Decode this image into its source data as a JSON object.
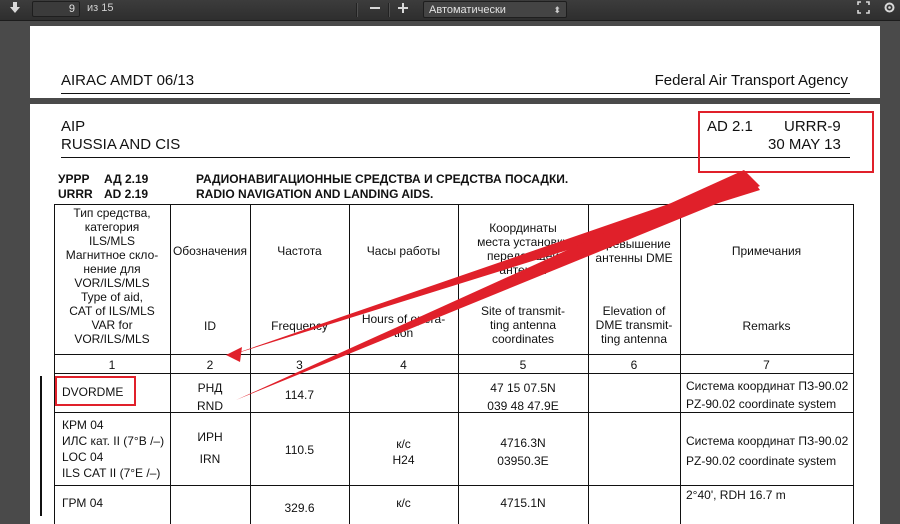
{
  "toolbar": {
    "page_number": "9",
    "page_of": "из 15",
    "zoom_value": "Автоматически",
    "icons": [
      "download-icon",
      "zoom-out-icon",
      "zoom-in-icon",
      "fullscreen-icon",
      "settings-icon"
    ]
  },
  "page_prev": {
    "amdt": "AIRAC AMDT 06/13",
    "agency": "Federal Air Transport Agency"
  },
  "page_header": {
    "aip": "AIP",
    "region": "RUSSIA AND CIS",
    "ad": "AD 2.1",
    "code": "URRR-9",
    "date": "30 MAY 13"
  },
  "section": {
    "code_ru": "УРРР",
    "num_ru": "АД 2.19",
    "code_en": "URRR",
    "num_en": "AD 2.19",
    "title_ru": "РАДИОНАВИГАЦИОННЫЕ СРЕДСТВА И СРЕДСТВА ПОСАДКИ.",
    "title_en": "RADIO NAVIGATION AND LANDING AIDS."
  },
  "table": {
    "headers_ru": [
      "Тип средства, категория ILS/MLS Магнитное скло-нение для VOR/ILS/MLS",
      "Обозначения",
      "Частота",
      "Часы работы",
      "Координаты места установки передающей антенны",
      "Превышение антенны DME",
      "Примечания"
    ],
    "h1_lines": [
      "Тип средства,",
      "категория",
      "ILS/MLS",
      "Магнитное скло-",
      "нение для",
      "VOR/ILS/MLS",
      "Type of aid,",
      "CAT of ILS/MLS",
      "VAR for",
      "VOR/ILS/MLS"
    ],
    "h5_lines": [
      "Координаты",
      "места установки",
      "передающей",
      "антенны"
    ],
    "h5_en_lines": [
      "Site of transmit-",
      "ting antenna",
      "coordinates"
    ],
    "h6_lines": [
      "Превышение",
      "антенны DME"
    ],
    "h6_en_lines": [
      "Elevation of",
      "DME transmit-",
      "ting antenna"
    ],
    "h4_en_lines": [
      "Hours of opera-",
      "tion"
    ],
    "h2": "Обозначения",
    "h3": "Частота",
    "h4": "Часы работы",
    "h7": "Примечания",
    "h2_en": "ID",
    "h3_en": "Frequency",
    "h7_en": "Remarks",
    "col_numbers": [
      "1",
      "2",
      "3",
      "4",
      "5",
      "6",
      "7"
    ],
    "rows": [
      {
        "type_lines": [
          "DVORDME"
        ],
        "id_lines": [
          "РНД",
          "RND"
        ],
        "freq": "114.7",
        "hours_lines": [],
        "coords_lines": [
          "47 15 07.5N",
          "039 48 47.9E"
        ],
        "remarks_lines": [
          "Система координат ПЗ-90.02",
          "PZ-90.02 coordinate system"
        ]
      },
      {
        "type_lines": [
          "КРМ 04",
          "ИЛС кат. II (7°В /–)",
          "LOC 04",
          "ILS CAT II (7°E /–)"
        ],
        "id_lines": [
          "ИРН",
          "IRN"
        ],
        "freq": "110.5",
        "hours_lines": [
          "к/с",
          "H24"
        ],
        "coords_lines": [
          "4716.3N",
          "03950.3E"
        ],
        "remarks_lines": [
          "Система координат ПЗ-90.02",
          "PZ-90.02 coordinate system"
        ]
      },
      {
        "type_lines": [
          "ГРМ 04"
        ],
        "id_lines": [],
        "freq": "329.6",
        "hours_lines": [
          "к/с"
        ],
        "coords_lines": [
          "4715.1N"
        ],
        "remarks_lines": [
          "2°40', RDH 16.7 m"
        ]
      }
    ]
  },
  "annotations": {
    "color": "#e0202a"
  }
}
